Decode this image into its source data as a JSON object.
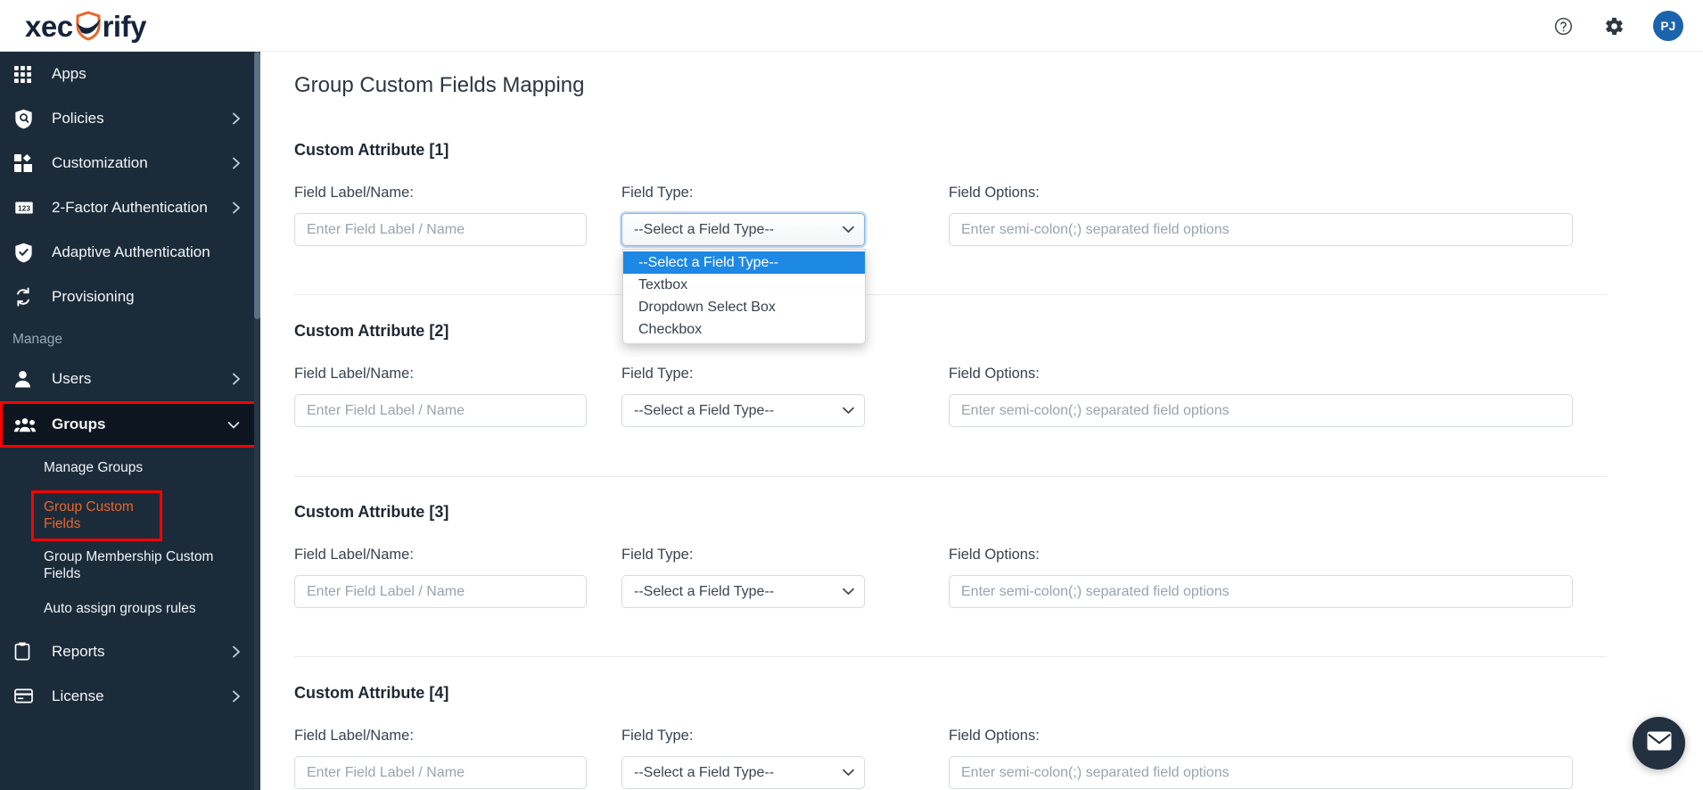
{
  "brand": {
    "logo_prefix": "xec",
    "logo_suffix": "rify",
    "logo_accent_color": "#e8662a",
    "logo_dark_color": "#16243b"
  },
  "topbar": {
    "help_icon": "question-circle-icon",
    "settings_icon": "gear-icon",
    "avatar_initials": "PJ",
    "avatar_color": "#1b63ad"
  },
  "sidebar": {
    "background": "#1c2b3a",
    "highlight_border_color": "#ff0000",
    "active_link_color": "#e8662a",
    "items": [
      {
        "label": "Apps",
        "icon": "grid-apps-icon",
        "has_chevron": false
      },
      {
        "label": "Policies",
        "icon": "policy-shield-icon",
        "has_chevron": true
      },
      {
        "label": "Customization",
        "icon": "customization-icon",
        "has_chevron": true
      },
      {
        "label": "2-Factor Authentication",
        "icon": "numeric-123-icon",
        "has_chevron": true
      },
      {
        "label": "Adaptive Authentication",
        "icon": "shield-check-icon",
        "has_chevron": false
      },
      {
        "label": "Provisioning",
        "icon": "sync-arrows-icon",
        "has_chevron": false
      }
    ],
    "section_label": "Manage",
    "manage_items": [
      {
        "label": "Users",
        "icon": "user-icon",
        "has_chevron": true
      },
      {
        "label": "Groups",
        "icon": "users-group-icon",
        "has_chevron": true,
        "highlighted": true
      }
    ],
    "group_subitems": [
      {
        "label": "Manage Groups",
        "boxed": false
      },
      {
        "label": "Group Custom Fields",
        "boxed": true
      },
      {
        "label": "Group Membership Custom Fields",
        "boxed": false
      },
      {
        "label": "Auto assign groups rules",
        "boxed": false
      }
    ],
    "footer_items": [
      {
        "label": "Reports",
        "icon": "clipboard-icon",
        "has_chevron": true
      },
      {
        "label": "License",
        "icon": "card-icon",
        "has_chevron": true
      }
    ]
  },
  "main": {
    "page_title": "Group Custom Fields Mapping",
    "labels": {
      "field_label_name": "Field Label/Name:",
      "field_type": "Field Type:",
      "field_options": "Field Options:"
    },
    "placeholders": {
      "field_label_name": "Enter Field Label / Name",
      "field_options": "Enter semi-colon(;) separated field options"
    },
    "select_default": "--Select a Field Type--",
    "field_type_options": [
      "--Select a Field Type--",
      "Textbox",
      "Dropdown Select Box",
      "Checkbox"
    ],
    "open_dropdown_row": 1,
    "selected_option": "--Select a Field Type--",
    "attributes": [
      {
        "title": "Custom Attribute [1]",
        "label_value": "",
        "type_value": "--Select a Field Type--",
        "options_value": ""
      },
      {
        "title": "Custom Attribute [2]",
        "label_value": "",
        "type_value": "--Select a Field Type--",
        "options_value": ""
      },
      {
        "title": "Custom Attribute [3]",
        "label_value": "",
        "type_value": "--Select a Field Type--",
        "options_value": ""
      },
      {
        "title": "Custom Attribute [4]",
        "label_value": "",
        "type_value": "--Select a Field Type--",
        "options_value": ""
      }
    ]
  },
  "fab": {
    "icon": "envelope-chat-icon"
  }
}
